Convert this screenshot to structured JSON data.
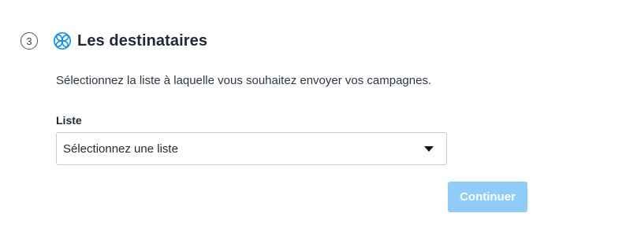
{
  "step": {
    "number": "3",
    "icon": "sendinblue-swirl-icon",
    "title": "Les destinataires"
  },
  "description": "Sélectionnez la liste à laquelle vous souhaitez envoyer vos campagnes.",
  "list_field": {
    "label": "Liste",
    "selected_value": "Sélectionnez une liste",
    "caret_icon": "caret-down-icon"
  },
  "actions": {
    "continue_label": "Continuer",
    "continue_disabled": true
  },
  "colors": {
    "brand_icon": "#0b8ff0",
    "button_disabled_bg": "#8fccf7",
    "text_primary": "#1f2937",
    "border": "#c4c9d2"
  }
}
